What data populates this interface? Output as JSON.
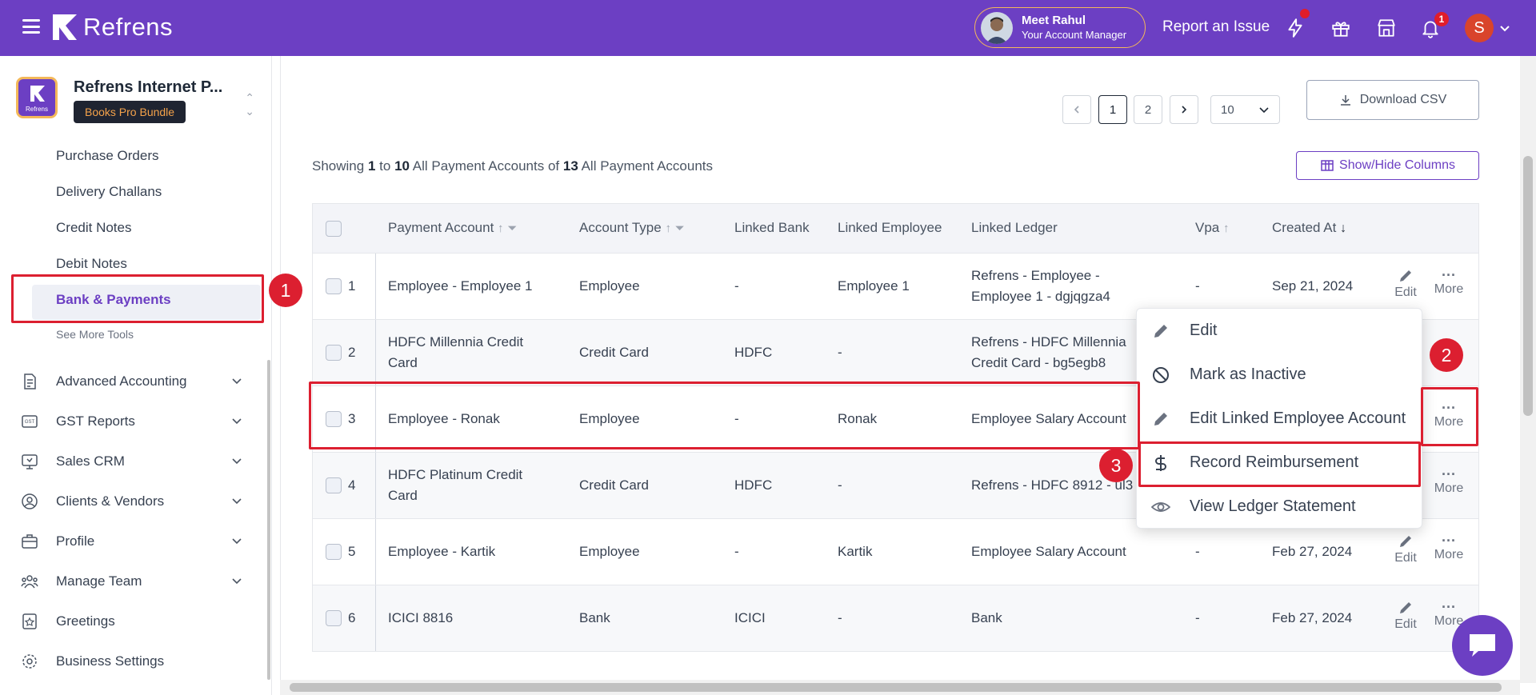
{
  "header": {
    "brand": "Refrens",
    "manager_name": "Meet Rahul",
    "manager_role": "Your Account Manager",
    "report_issue": "Report an Issue",
    "notification_count": "1",
    "user_initial": "S",
    "icons": [
      "menu-icon",
      "lightning-icon",
      "gift-icon",
      "store-icon",
      "bell-icon",
      "chevron-down-icon"
    ]
  },
  "sidebar": {
    "org_name": "Refrens Internet P...",
    "org_logo_text": "Refrens",
    "plan_badge": "Books Pro Bundle",
    "sub_items": [
      "Purchase Orders",
      "Delivery Challans",
      "Credit Notes",
      "Debit Notes",
      "Bank & Payments"
    ],
    "see_more": "See More Tools",
    "groups": [
      {
        "label": "Advanced Accounting",
        "icon": "document-icon",
        "expandable": true
      },
      {
        "label": "GST Reports",
        "icon": "gst-icon",
        "expandable": true
      },
      {
        "label": "Sales CRM",
        "icon": "crm-icon",
        "expandable": true
      },
      {
        "label": "Clients & Vendors",
        "icon": "user-circle-icon",
        "expandable": true
      },
      {
        "label": "Profile",
        "icon": "briefcase-icon",
        "expandable": true
      },
      {
        "label": "Manage Team",
        "icon": "team-icon",
        "expandable": true
      },
      {
        "label": "Greetings",
        "icon": "greetings-icon",
        "expandable": false
      },
      {
        "label": "Business Settings",
        "icon": "gear-icon",
        "expandable": false
      }
    ],
    "active_item": "Bank & Payments"
  },
  "toolbar": {
    "download_csv": "Download CSV",
    "showing_prefix": "Showing",
    "range_start": "1",
    "range_to": "to",
    "range_end": "10",
    "entity_label": "All Payment Accounts",
    "of_label": "of",
    "total": "13",
    "entity_label_2": "All Payment Accounts",
    "pages": [
      "1",
      "2"
    ],
    "current_page": "1",
    "page_size": "10",
    "show_hide_columns": "Show/Hide Columns"
  },
  "table": {
    "columns": [
      "Payment Account",
      "Account Type",
      "Linked Bank",
      "Linked Employee",
      "Linked Ledger",
      "Vpa",
      "Created At"
    ],
    "rows": [
      {
        "n": "1",
        "account": [
          "Employee - Employee 1"
        ],
        "type": "Employee",
        "bank": "-",
        "employee": "Employee 1",
        "ledger": [
          "Refrens - Employee -",
          "Employee 1 - dgjqgza4"
        ],
        "vpa": "-",
        "created": "Sep 21, 2024",
        "actions": true
      },
      {
        "n": "2",
        "account": [
          "HDFC Millennia Credit",
          "Card"
        ],
        "type": "Credit Card",
        "bank": "HDFC",
        "employee": "-",
        "ledger": [
          "Refrens - HDFC Millennia",
          "Credit Card - bg5egb8"
        ],
        "vpa": "",
        "created": "",
        "actions": false
      },
      {
        "n": "3",
        "account": [
          "Employee - Ronak"
        ],
        "type": "Employee",
        "bank": "-",
        "employee": "Ronak",
        "ledger": [
          "Employee Salary Account"
        ],
        "vpa": "",
        "created": "",
        "actions": "more"
      },
      {
        "n": "4",
        "account": [
          "HDFC Platinum Credit",
          "Card"
        ],
        "type": "Credit Card",
        "bank": "HDFC",
        "employee": "-",
        "ledger": [
          "Refrens - HDFC 8912 - ul3"
        ],
        "vpa": "",
        "created": "",
        "actions": "more"
      },
      {
        "n": "5",
        "account": [
          "Employee - Kartik"
        ],
        "type": "Employee",
        "bank": "-",
        "employee": "Kartik",
        "ledger": [
          "Employee Salary Account"
        ],
        "vpa": "-",
        "created": "Feb 27, 2024",
        "actions": true
      },
      {
        "n": "6",
        "account": [
          "ICICI 8816"
        ],
        "type": "Bank",
        "bank": "ICICI",
        "employee": "-",
        "ledger": [
          "Bank"
        ],
        "vpa": "-",
        "created": "Feb 27, 2024",
        "actions": true
      }
    ],
    "edit_label": "Edit",
    "more_label": "More"
  },
  "context_menu": {
    "items": [
      {
        "label": "Edit",
        "icon": "pencil-icon"
      },
      {
        "label": "Mark as Inactive",
        "icon": "ban-icon"
      },
      {
        "label": "Edit Linked Employee Account",
        "icon": "pencil-icon"
      },
      {
        "label": "Record Reimbursement",
        "icon": "dollar-icon"
      },
      {
        "label": "View Ledger Statement",
        "icon": "eye-icon"
      }
    ]
  },
  "annotations": {
    "steps": [
      "1",
      "2",
      "3"
    ],
    "highlight_color": "#dc1f30"
  },
  "colors": {
    "brand": "#6c3fc3",
    "accent": "#f4b85a",
    "active_text": "#6c3fc3"
  }
}
